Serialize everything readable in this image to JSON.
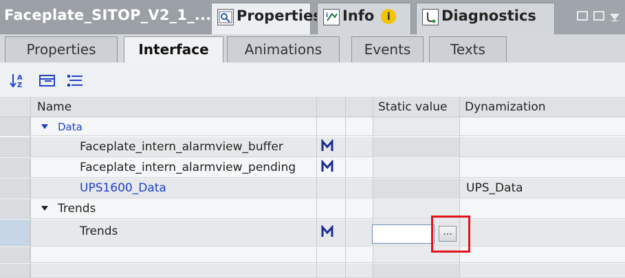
{
  "panel": {
    "title": "Faceplate_SITOP_V2_1_...",
    "tabs": [
      {
        "label": "Properties",
        "icon": "properties-magnifier-icon"
      },
      {
        "label": "Info",
        "icon": "info-arrow-icon",
        "badge": "i"
      },
      {
        "label": "Diagnostics",
        "icon": "diagnostics-icon"
      }
    ]
  },
  "subtabs": [
    "Properties",
    "Interface",
    "Animations",
    "Events",
    "Texts"
  ],
  "active_subtab": "Interface",
  "toolbar": {
    "icons": [
      "sort-az-icon",
      "expand-folder-icon",
      "collapse-list-icon"
    ]
  },
  "grid": {
    "columns": {
      "name": "Name",
      "static_value": "Static value",
      "dynamization": "Dynamization"
    },
    "rows": [
      {
        "name": "Data",
        "dynamization": ""
      },
      {
        "name": "Faceplate_intern_alarmview_buffer",
        "dynamization": ""
      },
      {
        "name": "Faceplate_intern_alarmview_pending",
        "dynamization": ""
      },
      {
        "name": "UPS1600_Data",
        "dynamization": "UPS_Data"
      },
      {
        "name": "Trends",
        "dynamization": ""
      },
      {
        "name": "Trends",
        "dynamization": ""
      }
    ],
    "ellipsis": "..."
  },
  "colors": {
    "accent_blue": "#1f3fcf",
    "highlight_red": "#e0141c",
    "interface_icon": "#1c2d8f"
  }
}
